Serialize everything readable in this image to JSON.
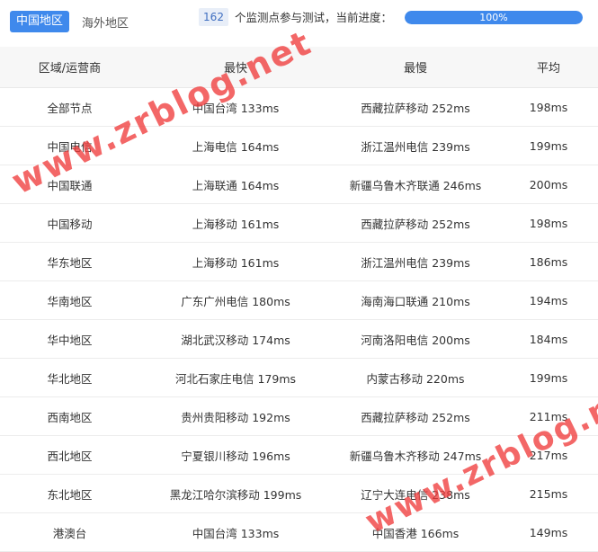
{
  "tabs": [
    {
      "label": "中国地区",
      "active": true
    },
    {
      "label": "海外地区",
      "active": false
    }
  ],
  "status": {
    "count": "162",
    "text": "个监测点参与测试，当前进度：",
    "progress_label": "100%",
    "progress_value": 1.0
  },
  "table": {
    "headers": [
      "区域/运营商",
      "最快",
      "最慢",
      "平均"
    ],
    "rows": [
      [
        "全部节点",
        "中国台湾 133ms",
        "西藏拉萨移动 252ms",
        "198ms"
      ],
      [
        "中国电信",
        "上海电信 164ms",
        "浙江温州电信 239ms",
        "199ms"
      ],
      [
        "中国联通",
        "上海联通 164ms",
        "新疆乌鲁木齐联通 246ms",
        "200ms"
      ],
      [
        "中国移动",
        "上海移动 161ms",
        "西藏拉萨移动 252ms",
        "198ms"
      ],
      [
        "华东地区",
        "上海移动 161ms",
        "浙江温州电信 239ms",
        "186ms"
      ],
      [
        "华南地区",
        "广东广州电信 180ms",
        "海南海口联通 210ms",
        "194ms"
      ],
      [
        "华中地区",
        "湖北武汉移动 174ms",
        "河南洛阳电信 200ms",
        "184ms"
      ],
      [
        "华北地区",
        "河北石家庄电信 179ms",
        "内蒙古移动 220ms",
        "199ms"
      ],
      [
        "西南地区",
        "贵州贵阳移动 192ms",
        "西藏拉萨移动 252ms",
        "211ms"
      ],
      [
        "西北地区",
        "宁夏银川移动 196ms",
        "新疆乌鲁木齐移动 247ms",
        "217ms"
      ],
      [
        "东北地区",
        "黑龙江哈尔滨移动 199ms",
        "辽宁大连电信 238ms",
        "215ms"
      ],
      [
        "港澳台",
        "中国台湾 133ms",
        "中国香港 166ms",
        "149ms"
      ]
    ]
  },
  "watermark": {
    "text": "www.zrblog.net",
    "color": "#f03c3c"
  }
}
